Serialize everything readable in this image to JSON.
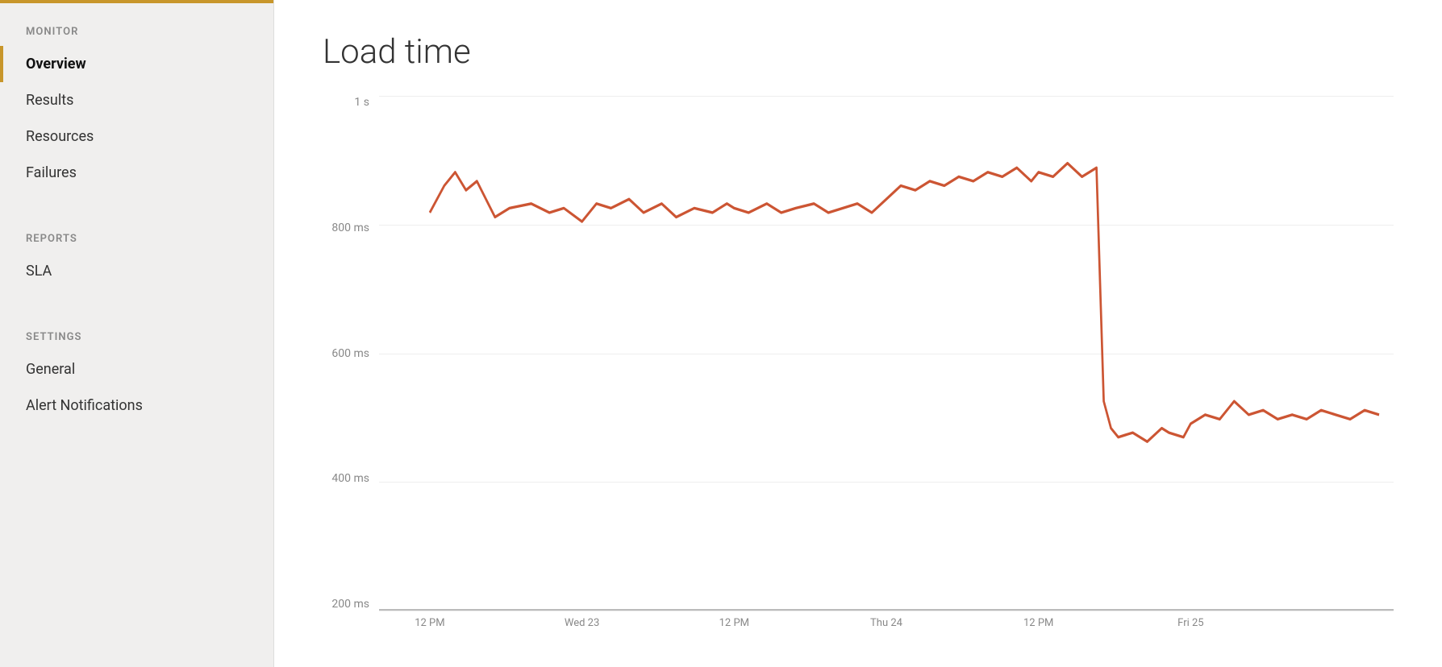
{
  "sidebar": {
    "monitor_label": "MONITOR",
    "overview_label": "Overview",
    "results_label": "Results",
    "resources_label": "Resources",
    "failures_label": "Failures",
    "reports_label": "REPORTS",
    "sla_label": "SLA",
    "settings_label": "SETTINGS",
    "general_label": "General",
    "alert_notifications_label": "Alert Notifications"
  },
  "chart": {
    "title": "Load time",
    "y_labels": [
      "1 s",
      "800 ms",
      "600 ms",
      "400 ms",
      "200 ms"
    ],
    "x_labels": [
      "12 PM",
      "Wed 23",
      "12 PM",
      "Thu 24",
      "12 PM",
      "Fri 25"
    ],
    "accent_color": "#c8962a",
    "line_color": "#cc5533"
  }
}
